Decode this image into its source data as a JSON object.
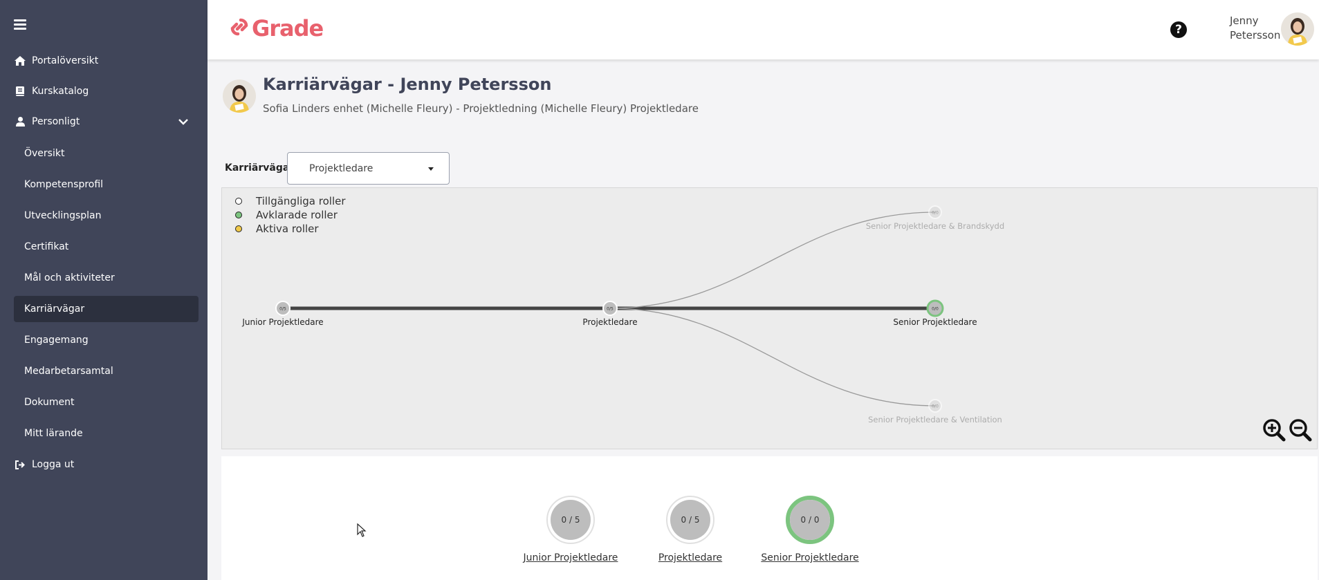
{
  "sidebar": {
    "items": [
      {
        "label": "Portalöversikt",
        "icon": "home-icon"
      },
      {
        "label": "Kurskatalog",
        "icon": "book-icon"
      },
      {
        "label": "Personligt",
        "icon": "user-icon"
      }
    ],
    "sub_items": [
      {
        "label": "Översikt"
      },
      {
        "label": "Kompetensprofil"
      },
      {
        "label": "Utvecklingsplan"
      },
      {
        "label": "Certifikat"
      },
      {
        "label": "Mål och aktiviteter"
      },
      {
        "label": "Karriärvägar",
        "active": true
      },
      {
        "label": "Engagemang"
      },
      {
        "label": "Medarbetarsamtal"
      },
      {
        "label": "Dokument"
      },
      {
        "label": "Mitt lärande"
      }
    ],
    "logout": {
      "label": "Logga ut",
      "icon": "logout-icon"
    }
  },
  "header": {
    "logo_text": "Grade",
    "user_first": "Jenny",
    "user_last": "Petersson",
    "help_glyph": "?"
  },
  "page": {
    "title": "Karriärvägar - Jenny Petersson",
    "subtitle": "Sofia Linders enhet (Michelle Fleury) - Projektledning (Michelle Fleury) Projektledare"
  },
  "career_selector": {
    "label": "Karriärvägar:",
    "value": "Projektledare"
  },
  "legend": [
    {
      "label": "Tillgängliga roller",
      "color": "#ffffff"
    },
    {
      "label": "Avklarade roller",
      "color": "#7cc47f"
    },
    {
      "label": "Aktiva roller",
      "color": "#f0c94a"
    }
  ],
  "graph": {
    "nodes": [
      {
        "label": "Junior Projektledare",
        "badge": "0/5"
      },
      {
        "label": "Projektledare",
        "badge": "0/5"
      },
      {
        "label": "Senior Projektledare",
        "badge": "0/0"
      },
      {
        "label": "Senior Projektledare & Brandskydd",
        "badge": "0/0"
      },
      {
        "label": "Senior Projektledare & Ventilation",
        "badge": "0/0"
      }
    ]
  },
  "roles": [
    {
      "label": "Junior Projektledare",
      "progress": "0 / 5",
      "completed": false
    },
    {
      "label": "Projektledare",
      "progress": "0 / 5",
      "completed": false
    },
    {
      "label": "Senior Projektledare",
      "progress": "0 / 0",
      "completed": true
    }
  ],
  "colors": {
    "sidebar": "#404559",
    "sidebar_active": "#2c303e",
    "brand": "#e8616d",
    "completed": "#7cc47f"
  }
}
